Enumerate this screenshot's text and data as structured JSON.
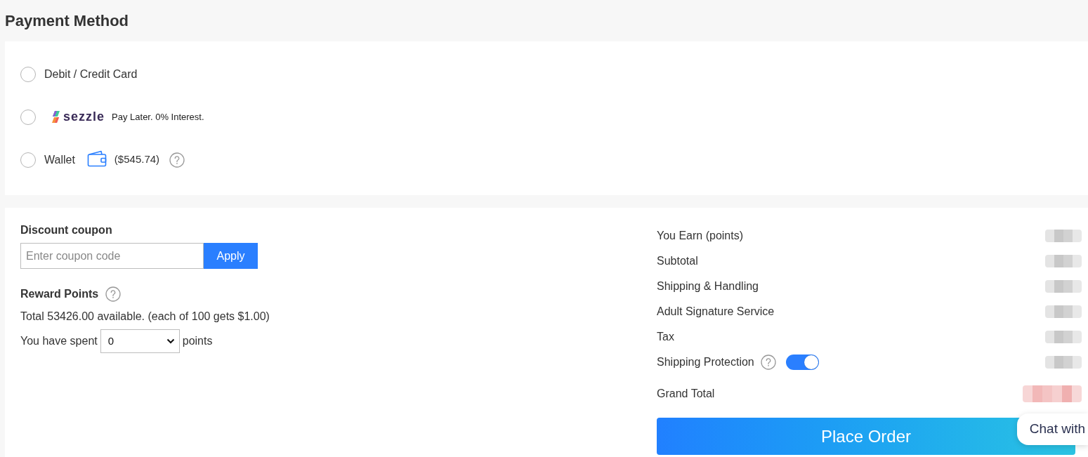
{
  "page": {
    "title": "Payment Method"
  },
  "payment": {
    "options": [
      {
        "kind": "text",
        "label": "Debit / Credit Card",
        "selected": false
      },
      {
        "kind": "sezzle",
        "logo_text": "sezzle",
        "tagline": "Pay Later. 0% Interest.",
        "selected": false
      },
      {
        "kind": "wallet",
        "label": "Wallet",
        "amount": "($545.74)",
        "selected": false
      }
    ]
  },
  "coupon": {
    "title": "Discount coupon",
    "placeholder": "Enter coupon code",
    "button": "Apply"
  },
  "rewards": {
    "title": "Reward Points",
    "summary": "Total 53426.00 available. (each of 100 gets $1.00)",
    "spent_prefix": "You have spent",
    "spent_value": "0",
    "spent_suffix": "points"
  },
  "summary": {
    "rows": [
      {
        "kind": "plain",
        "label": "You Earn (points)",
        "blurred": true
      },
      {
        "kind": "plain",
        "label": "Subtotal",
        "blurred": true
      },
      {
        "kind": "plain",
        "label": "Shipping & Handling",
        "blurred": true
      },
      {
        "kind": "plain",
        "label": "Adult Signature Service",
        "blurred": true
      },
      {
        "kind": "plain",
        "label": "Tax",
        "blurred": true
      },
      {
        "kind": "toggle",
        "label": "Shipping Protection",
        "on": true,
        "blurred": true
      },
      {
        "kind": "total",
        "label": "Grand Total",
        "blurred": true
      }
    ]
  },
  "place_order": {
    "label": "Place Order"
  },
  "chat": {
    "label": "Chat with"
  }
}
